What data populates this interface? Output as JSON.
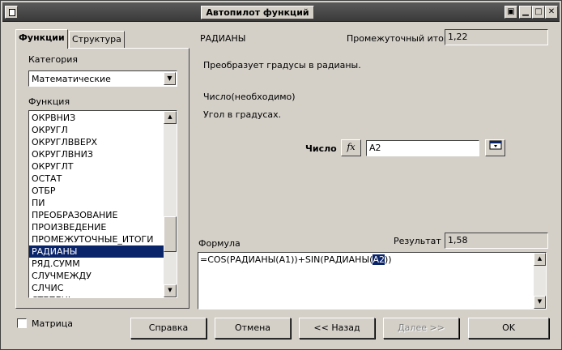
{
  "window": {
    "title": "Автопилот функций"
  },
  "tabs": [
    {
      "label": "Функции"
    },
    {
      "label": "Структура"
    }
  ],
  "left": {
    "category_label": "Категория",
    "category_value": "Математические",
    "function_label": "Функция",
    "functions": [
      "ОКРВНИЗ",
      "ОКРУГЛ",
      "ОКРУГЛВВЕРХ",
      "ОКРУГЛВНИЗ",
      "ОКРУГЛТ",
      "ОСТАТ",
      "ОТБР",
      "ПИ",
      "ПРЕОБРАЗОВАНИЕ",
      "ПРОИЗВЕДЕНИЕ",
      "ПРОМЕЖУТОЧНЫЕ_ИТОГИ",
      "РАДИАНЫ",
      "РЯД.СУММ",
      "СЛУЧМЕЖДУ",
      "СЛЧИС",
      "СТЕПЕНЬ"
    ],
    "selected_function": "РАДИАНЫ"
  },
  "right": {
    "function_name": "РАДИАНЫ",
    "interim_label": "Промежуточный итог",
    "interim_value": "1,22",
    "description": "Преобразует градусы в радианы.",
    "arg_signature": "Число(необходимо)",
    "arg_description": "Угол в градусах.",
    "arg_label": "Число",
    "arg_value": "A2",
    "fx_icon": "fx",
    "formula_label": "Формула",
    "result_label": "Результат",
    "result_value": "1,58",
    "formula_before": "=COS(РАДИАНЫ(A1))+SIN(РАДИАНЫ(",
    "formula_highlight": "A2",
    "formula_after": "))"
  },
  "bottom": {
    "matrix_label": "Матрица",
    "help_button": "Справка",
    "cancel_button": "Отмена",
    "back_button": "<< Назад",
    "next_button": "Далее >>",
    "ok_button": "OK"
  },
  "colors": {
    "selection": "#0a246a",
    "face": "#d4d0c8",
    "titlebar": "#4a4a4a"
  }
}
